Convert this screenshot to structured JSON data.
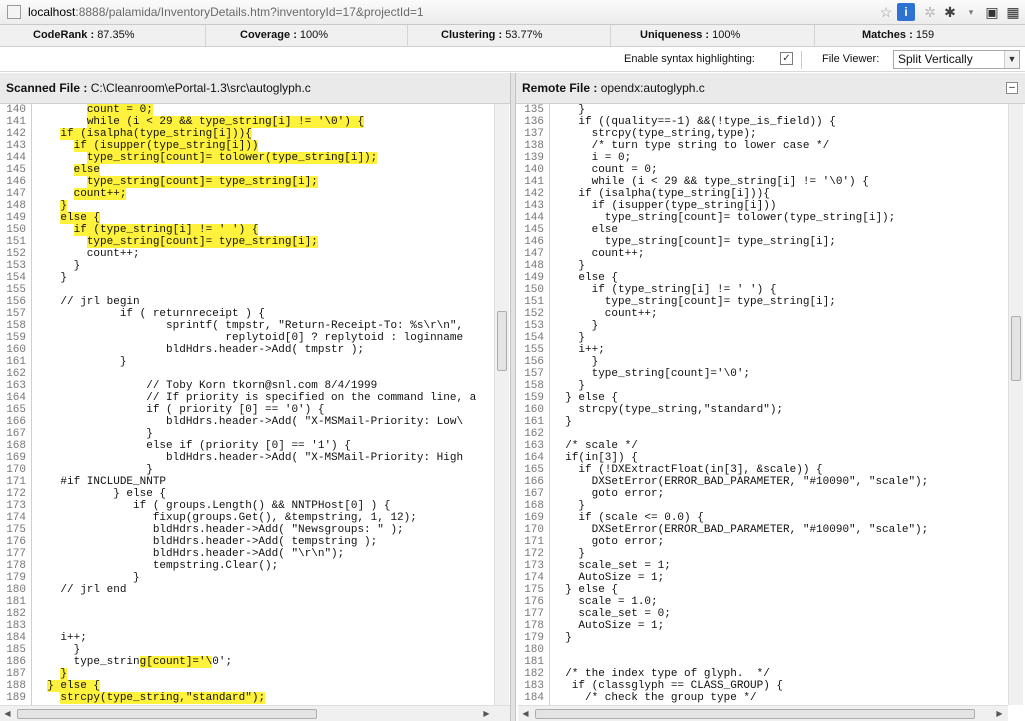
{
  "browser": {
    "url_host": "localhost",
    "url_path": ":8888/palamida/InventoryDetails.htm?inventoryId=17&projectId=1"
  },
  "stats": {
    "coderank_label": "CodeRank :",
    "coderank_value": "87.35%",
    "coverage_label": "Coverage :",
    "coverage_value": "100%",
    "clustering_label": "Clustering :",
    "clustering_value": "53.77%",
    "uniqueness_label": "Uniqueness :",
    "uniqueness_value": "100%",
    "matches_label": "Matches :",
    "matches_value": "159"
  },
  "options": {
    "syntax_label": "Enable syntax highlighting:",
    "syntax_checked": "✓",
    "viewer_label": "File Viewer:",
    "viewer_value": "Split Vertically"
  },
  "left_pane": {
    "title_label": "Scanned File :",
    "title_path": "C:\\Cleanroom\\ePortal-1.3\\src\\autoglyph.c",
    "lines": [
      {
        "n": "140",
        "t": "        count = 0;",
        "h": [
          [
            8,
            18
          ]
        ]
      },
      {
        "n": "141",
        "t": "        while (i < 29 && type_string[i] != '\\0') {",
        "h": [
          [
            8,
            50
          ]
        ]
      },
      {
        "n": "142",
        "t": "    if (isalpha(type_string[i])){",
        "h": [
          [
            4,
            33
          ]
        ]
      },
      {
        "n": "143",
        "t": "      if (isupper(type_string[i]))",
        "h": [
          [
            6,
            34
          ]
        ]
      },
      {
        "n": "144",
        "t": "        type_string[count]= tolower(type_string[i]);",
        "h": [
          [
            8,
            52
          ]
        ]
      },
      {
        "n": "145",
        "t": "      else",
        "h": [
          [
            6,
            10
          ]
        ]
      },
      {
        "n": "146",
        "t": "        type_string[count]= type_string[i];",
        "h": [
          [
            8,
            43
          ]
        ]
      },
      {
        "n": "147",
        "t": "      count++;",
        "h": [
          [
            6,
            14
          ]
        ]
      },
      {
        "n": "148",
        "t": "    }",
        "h": [
          [
            4,
            5
          ]
        ]
      },
      {
        "n": "149",
        "t": "    else {",
        "h": [
          [
            4,
            10
          ]
        ]
      },
      {
        "n": "150",
        "t": "      if (type_string[i] != ' ') {",
        "h": [
          [
            6,
            34
          ]
        ]
      },
      {
        "n": "151",
        "t": "        type_string[count]= type_string[i];",
        "h": [
          [
            8,
            43
          ]
        ]
      },
      {
        "n": "152",
        "t": "        count++;",
        "h": []
      },
      {
        "n": "153",
        "t": "      }",
        "h": []
      },
      {
        "n": "154",
        "t": "    }",
        "h": []
      },
      {
        "n": "155",
        "t": "",
        "h": []
      },
      {
        "n": "156",
        "t": "    // jrl begin",
        "h": []
      },
      {
        "n": "157",
        "t": "             if ( returnreceipt ) {",
        "h": []
      },
      {
        "n": "158",
        "t": "                    sprintf( tmpstr, \"Return-Receipt-To: %s\\r\\n\",",
        "h": []
      },
      {
        "n": "159",
        "t": "                             replytoid[0] ? replytoid : loginname",
        "h": []
      },
      {
        "n": "160",
        "t": "                    bldHdrs.header->Add( tmpstr );",
        "h": []
      },
      {
        "n": "161",
        "t": "             }",
        "h": []
      },
      {
        "n": "162",
        "t": "",
        "h": []
      },
      {
        "n": "163",
        "t": "                 // Toby Korn tkorn@snl.com 8/4/1999",
        "h": []
      },
      {
        "n": "164",
        "t": "                 // If priority is specified on the command line, a",
        "h": []
      },
      {
        "n": "165",
        "t": "                 if ( priority [0] == '0') {",
        "h": []
      },
      {
        "n": "166",
        "t": "                    bldHdrs.header->Add( \"X-MSMail-Priority: Low\\",
        "h": []
      },
      {
        "n": "167",
        "t": "                 }",
        "h": []
      },
      {
        "n": "168",
        "t": "                 else if (priority [0] == '1') {",
        "h": []
      },
      {
        "n": "169",
        "t": "                    bldHdrs.header->Add( \"X-MSMail-Priority: High",
        "h": []
      },
      {
        "n": "170",
        "t": "                 }",
        "h": []
      },
      {
        "n": "171",
        "t": "    #if INCLUDE_NNTP",
        "h": []
      },
      {
        "n": "172",
        "t": "            } else {",
        "h": []
      },
      {
        "n": "173",
        "t": "               if ( groups.Length() && NNTPHost[0] ) {",
        "h": []
      },
      {
        "n": "174",
        "t": "                  fixup(groups.Get(), &tempstring, 1, 12);",
        "h": []
      },
      {
        "n": "175",
        "t": "                  bldHdrs.header->Add( \"Newsgroups: \" );",
        "h": []
      },
      {
        "n": "176",
        "t": "                  bldHdrs.header->Add( tempstring );",
        "h": []
      },
      {
        "n": "177",
        "t": "                  bldHdrs.header->Add( \"\\r\\n\");",
        "h": []
      },
      {
        "n": "178",
        "t": "                  tempstring.Clear();",
        "h": []
      },
      {
        "n": "179",
        "t": "               }",
        "h": []
      },
      {
        "n": "180",
        "t": "    // jrl end",
        "h": []
      },
      {
        "n": "181",
        "t": "",
        "h": []
      },
      {
        "n": "182",
        "t": "",
        "h": []
      },
      {
        "n": "183",
        "t": "",
        "h": []
      },
      {
        "n": "184",
        "t": "    i++;",
        "h": []
      },
      {
        "n": "185",
        "t": "      }",
        "h": []
      },
      {
        "n": "186",
        "t": "      type_string[count]='\\0';",
        "h": [
          [
            16,
            27
          ]
        ]
      },
      {
        "n": "187",
        "t": "    }",
        "h": [
          [
            4,
            5
          ]
        ]
      },
      {
        "n": "188",
        "t": "  } else {",
        "h": [
          [
            2,
            10
          ]
        ]
      },
      {
        "n": "189",
        "t": "    strcpy(type_string,\"standard\");",
        "h": [
          [
            4,
            35
          ]
        ]
      }
    ]
  },
  "right_pane": {
    "title_label": "Remote File :",
    "title_path": "opendx:autoglyph.c",
    "lines": [
      {
        "n": "135",
        "t": "    }",
        "h": []
      },
      {
        "n": "136",
        "t": "    if ((quality==-1) &&(!type_is_field)) {",
        "h": []
      },
      {
        "n": "137",
        "t": "      strcpy(type_string,type);",
        "h": []
      },
      {
        "n": "138",
        "t": "      /* turn type string to lower case */",
        "h": []
      },
      {
        "n": "139",
        "t": "      i = 0;",
        "h": []
      },
      {
        "n": "140",
        "t": "      count = 0;",
        "h": []
      },
      {
        "n": "141",
        "t": "      while (i < 29 && type_string[i] != '\\0') {",
        "h": []
      },
      {
        "n": "142",
        "t": "    if (isalpha(type_string[i])){",
        "h": []
      },
      {
        "n": "143",
        "t": "      if (isupper(type_string[i]))",
        "h": []
      },
      {
        "n": "144",
        "t": "        type_string[count]= tolower(type_string[i]);",
        "h": []
      },
      {
        "n": "145",
        "t": "      else",
        "h": []
      },
      {
        "n": "146",
        "t": "        type_string[count]= type_string[i];",
        "h": []
      },
      {
        "n": "147",
        "t": "      count++;",
        "h": []
      },
      {
        "n": "148",
        "t": "    }",
        "h": []
      },
      {
        "n": "149",
        "t": "    else {",
        "h": []
      },
      {
        "n": "150",
        "t": "      if (type_string[i] != ' ') {",
        "h": []
      },
      {
        "n": "151",
        "t": "        type_string[count]= type_string[i];",
        "h": []
      },
      {
        "n": "152",
        "t": "        count++;",
        "h": []
      },
      {
        "n": "153",
        "t": "      }",
        "h": []
      },
      {
        "n": "154",
        "t": "    }",
        "h": []
      },
      {
        "n": "155",
        "t": "    i++;",
        "h": []
      },
      {
        "n": "156",
        "t": "      }",
        "h": []
      },
      {
        "n": "157",
        "t": "      type_string[count]='\\0';",
        "h": []
      },
      {
        "n": "158",
        "t": "    }",
        "h": []
      },
      {
        "n": "159",
        "t": "  } else {",
        "h": []
      },
      {
        "n": "160",
        "t": "    strcpy(type_string,\"standard\");",
        "h": []
      },
      {
        "n": "161",
        "t": "  }",
        "h": []
      },
      {
        "n": "162",
        "t": "",
        "h": []
      },
      {
        "n": "163",
        "t": "  /* scale */",
        "h": []
      },
      {
        "n": "164",
        "t": "  if(in[3]) {",
        "h": []
      },
      {
        "n": "165",
        "t": "    if (!DXExtractFloat(in[3], &scale)) {",
        "h": []
      },
      {
        "n": "166",
        "t": "      DXSetError(ERROR_BAD_PARAMETER, \"#10090\", \"scale\");",
        "h": []
      },
      {
        "n": "167",
        "t": "      goto error;",
        "h": []
      },
      {
        "n": "168",
        "t": "    }",
        "h": []
      },
      {
        "n": "169",
        "t": "    if (scale <= 0.0) {",
        "h": []
      },
      {
        "n": "170",
        "t": "      DXSetError(ERROR_BAD_PARAMETER, \"#10090\", \"scale\");",
        "h": []
      },
      {
        "n": "171",
        "t": "      goto error;",
        "h": []
      },
      {
        "n": "172",
        "t": "    }",
        "h": []
      },
      {
        "n": "173",
        "t": "    scale_set = 1;",
        "h": []
      },
      {
        "n": "174",
        "t": "    AutoSize = 1;",
        "h": []
      },
      {
        "n": "175",
        "t": "  } else {",
        "h": []
      },
      {
        "n": "176",
        "t": "    scale = 1.0;",
        "h": []
      },
      {
        "n": "177",
        "t": "    scale_set = 0;",
        "h": []
      },
      {
        "n": "178",
        "t": "    AutoSize = 1;",
        "h": []
      },
      {
        "n": "179",
        "t": "  }",
        "h": []
      },
      {
        "n": "180",
        "t": "",
        "h": []
      },
      {
        "n": "181",
        "t": "",
        "h": []
      },
      {
        "n": "182",
        "t": "  /* the index type of glyph.  */",
        "h": []
      },
      {
        "n": "183",
        "t": "   if (classglyph == CLASS_GROUP) {",
        "h": []
      },
      {
        "n": "184",
        "t": "     /* check the group type */",
        "h": []
      }
    ]
  },
  "colors": {
    "highlight": "#fff23c",
    "info_icon": "#2f73d2"
  }
}
